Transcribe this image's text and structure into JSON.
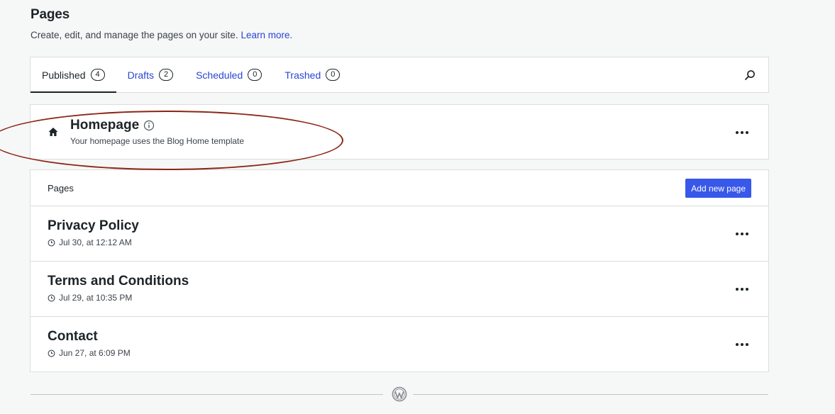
{
  "header": {
    "title": "Pages",
    "subtitle": "Create, edit, and manage the pages on your site.",
    "learn_more": "Learn more."
  },
  "tabs": [
    {
      "label": "Published",
      "count": "4",
      "active": true
    },
    {
      "label": "Drafts",
      "count": "2",
      "active": false
    },
    {
      "label": "Scheduled",
      "count": "0",
      "active": false
    },
    {
      "label": "Trashed",
      "count": "0",
      "active": false
    }
  ],
  "homepage": {
    "title": "Homepage",
    "description": "Your homepage uses the Blog Home template"
  },
  "pages_section": {
    "label": "Pages",
    "add_button": "Add new page",
    "items": [
      {
        "title": "Privacy Policy",
        "date": "Jul 30, at 12:12 AM"
      },
      {
        "title": "Terms and Conditions",
        "date": "Jul 29, at 10:35 PM"
      },
      {
        "title": "Contact",
        "date": "Jun 27, at 6:09 PM"
      }
    ]
  },
  "icons": {
    "search": "search-icon",
    "home": "house-icon",
    "info": "info-icon",
    "clock": "clock-icon",
    "more": "ellipsis-icon",
    "brand": "wordpress-logo-icon"
  },
  "colors": {
    "accent": "#3858e9",
    "link": "#2945d4",
    "annotation": "#8b2514"
  }
}
